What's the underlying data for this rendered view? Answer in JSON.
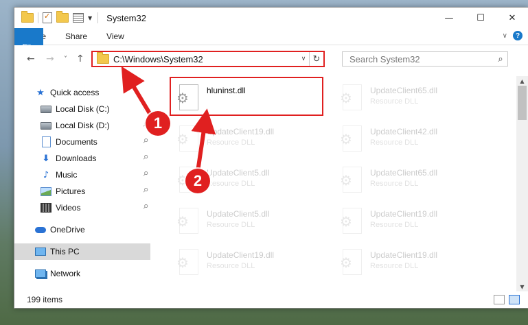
{
  "titlebar": {
    "title": "System32",
    "controls": {
      "minimize": "—",
      "maximize": "☐",
      "close": "✕"
    }
  },
  "ribbon": {
    "tabs": [
      "File",
      "Home",
      "Share",
      "View"
    ],
    "expand_icon": "chevron-down-icon",
    "help": "?"
  },
  "nav": {
    "back": "←",
    "forward": "→",
    "recent": "˅",
    "up": "↑",
    "address": "C:\\Windows\\System32",
    "refresh": "↻",
    "search_placeholder": "Search System32",
    "search_icon": "⌕"
  },
  "sidebar": {
    "items": [
      {
        "label": "Quick access",
        "icon": "star-icon"
      },
      {
        "label": "Local Disk (C:)",
        "icon": "drive-icon",
        "pinned": true
      },
      {
        "label": "Local Disk (D:)",
        "icon": "drive-icon",
        "pinned": true
      },
      {
        "label": "Documents",
        "icon": "documents-icon",
        "pinned": true
      },
      {
        "label": "Downloads",
        "icon": "downloads-icon",
        "pinned": true
      },
      {
        "label": "Music",
        "icon": "music-icon",
        "pinned": true
      },
      {
        "label": "Pictures",
        "icon": "pictures-icon",
        "pinned": true
      },
      {
        "label": "Videos",
        "icon": "videos-icon",
        "pinned": true
      },
      {
        "label": "OneDrive",
        "icon": "onedrive-icon"
      },
      {
        "label": "This PC",
        "icon": "this-pc-icon",
        "selected": true
      },
      {
        "label": "Network",
        "icon": "network-icon"
      }
    ]
  },
  "files": {
    "items": [
      {
        "name": "hluninst.dll",
        "type": ""
      },
      {
        "name": "UpdateClient65.dll",
        "type": "Resource DLL"
      },
      {
        "name": "UpdateClient19.dll",
        "type": "Resource DLL"
      },
      {
        "name": "UpdateClient42.dll",
        "type": "Resource DLL"
      },
      {
        "name": "UpdateClient5.dll",
        "type": "Resource DLL"
      },
      {
        "name": "UpdateClient65.dll",
        "type": "Resource DLL"
      },
      {
        "name": "UpdateClient5.dll",
        "type": "Resource DLL"
      },
      {
        "name": "UpdateClient19.dll",
        "type": "Resource DLL"
      },
      {
        "name": "UpdateClient19.dll",
        "type": "Resource DLL"
      },
      {
        "name": "UpdateClient19.dll",
        "type": "Resource DLL"
      }
    ]
  },
  "status": {
    "count": "199 items"
  },
  "callouts": {
    "one": "1",
    "two": "2"
  },
  "colors": {
    "accent": "#1979ca",
    "callout": "#e02020",
    "selected": "#d9d9d9"
  }
}
